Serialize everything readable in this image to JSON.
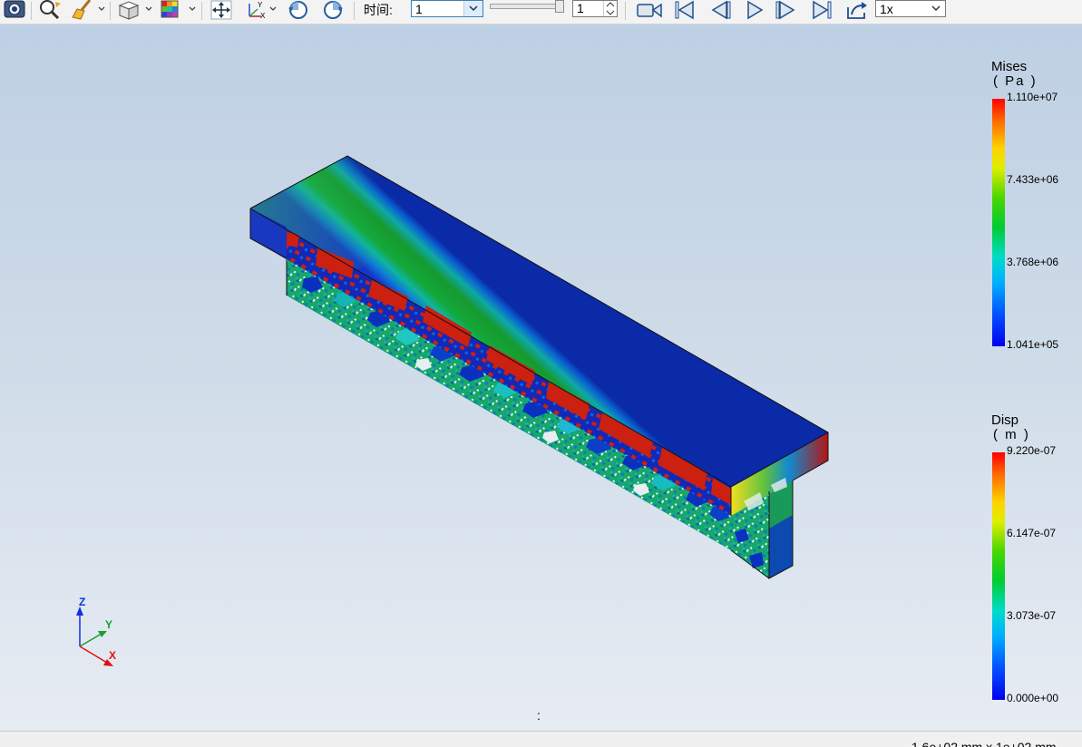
{
  "toolbar": {
    "time_label": "时间:",
    "time_value": "1",
    "frame_value": "1",
    "speed_value": "1x",
    "tools": [
      "camera-icon",
      "zoom-icon",
      "brush-icon",
      "view-cube-icon",
      "color-map-icon",
      "pan-icon",
      "axes-icon",
      "rotate-left-icon",
      "rotate-right-icon",
      "record-icon",
      "first-frame-icon",
      "previous-frame-icon",
      "play-icon",
      "next-frame-icon",
      "last-frame-icon",
      "export-icon"
    ]
  },
  "legends": [
    {
      "title": "Mises",
      "unit": "( Pa )",
      "ticks": [
        "1.110e+07",
        "7.433e+06",
        "3.768e+06",
        "1.041e+05"
      ]
    },
    {
      "title": "Disp",
      "unit": "( m )",
      "ticks": [
        "9.220e-07",
        "6.147e-07",
        "3.073e-07",
        "0.000e+00"
      ]
    }
  ],
  "axes": {
    "z": "Z",
    "y": "Y",
    "x": "X"
  },
  "viewport_marker": ":",
  "status": {
    "dimensions": "1.6e+02 mm x 1e+02 mm"
  },
  "colors": {
    "high": "#ff0000",
    "mid": "#00cc33",
    "low": "#0000ee",
    "background_top": "#bed0e4",
    "background_bottom": "#e7ecf3"
  }
}
